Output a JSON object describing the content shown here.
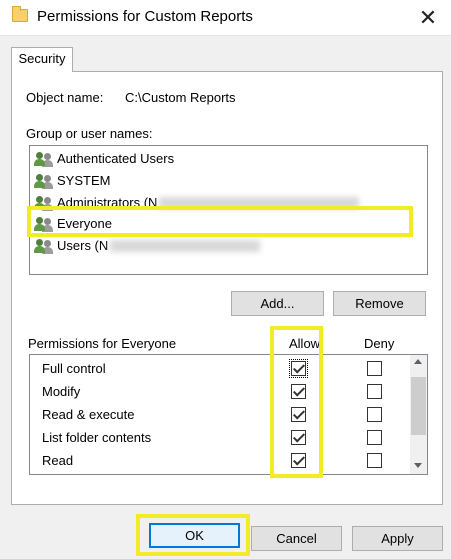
{
  "window": {
    "title": "Permissions for Custom Reports",
    "close_symbol": "✕"
  },
  "tabs": [
    {
      "label": "Security"
    }
  ],
  "object": {
    "label": "Object name:",
    "value": "C:\\Custom Reports"
  },
  "groups": {
    "label": "Group or user names:",
    "items": [
      {
        "label": "Authenticated Users",
        "icon": "users-icon"
      },
      {
        "label": "SYSTEM",
        "icon": "users-icon"
      },
      {
        "label": "Administrators (N",
        "icon": "users-icon",
        "redacted": true
      },
      {
        "label": "Everyone",
        "icon": "users-icon",
        "selected": true
      },
      {
        "label": "Users (N",
        "icon": "users-icon",
        "redacted": true
      }
    ],
    "add_label": "Add...",
    "remove_label": "Remove"
  },
  "permissions": {
    "header": "Permissions for Everyone",
    "allow_label": "Allow",
    "deny_label": "Deny",
    "rows": [
      {
        "name": "Full control",
        "allow": true,
        "deny": false
      },
      {
        "name": "Modify",
        "allow": true,
        "deny": false
      },
      {
        "name": "Read & execute",
        "allow": true,
        "deny": false
      },
      {
        "name": "List folder contents",
        "allow": true,
        "deny": false
      },
      {
        "name": "Read",
        "allow": true,
        "deny": false
      }
    ]
  },
  "footer": {
    "ok_label": "OK",
    "cancel_label": "Cancel",
    "apply_label": "Apply"
  },
  "colors": {
    "highlight": "#f2ec26",
    "focus_border": "#0078d7"
  }
}
